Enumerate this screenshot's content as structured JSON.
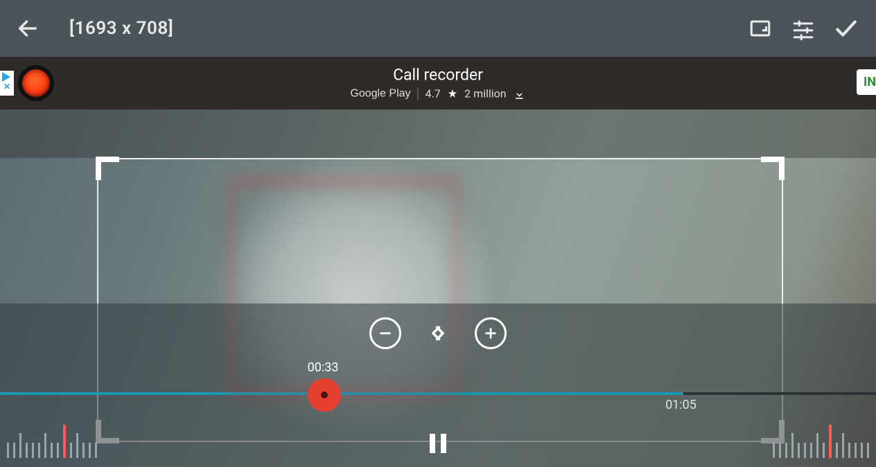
{
  "toolbar": {
    "dimensions": "[1693 x  708]"
  },
  "ad": {
    "title": "Call recorder",
    "store": "Google Play",
    "rating": "4.7",
    "downloads": "2 million",
    "install": "IN"
  },
  "timeline": {
    "current": "00:33",
    "end": "01:05",
    "progress_pct": 37
  }
}
